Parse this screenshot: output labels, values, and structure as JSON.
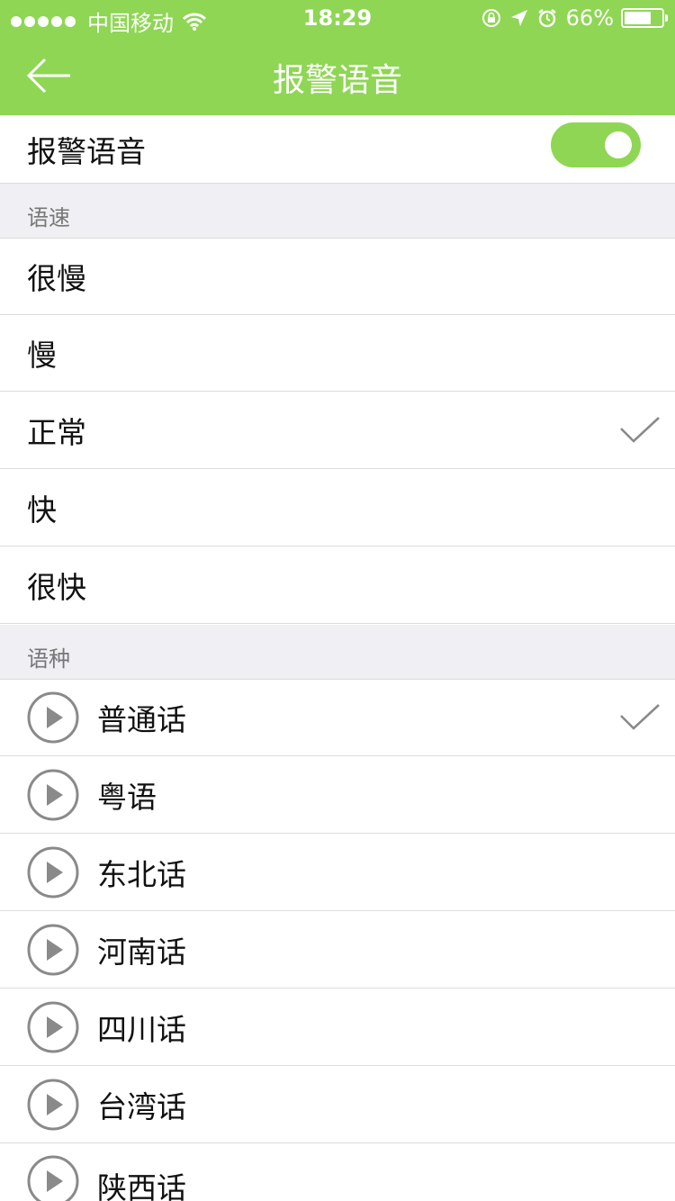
{
  "status_bar": {
    "carrier": "中国移动",
    "time": "18:29",
    "battery": "66%"
  },
  "nav": {
    "title": "报警语音"
  },
  "alarm_toggle": {
    "label": "报警语音",
    "enabled": true
  },
  "speed_section": {
    "header": "语速",
    "options": [
      "很慢",
      "慢",
      "正常",
      "快",
      "很快"
    ],
    "selected": "正常"
  },
  "language_section": {
    "header": "语种",
    "options": [
      "普通话",
      "粤语",
      "东北话",
      "河南话",
      "四川话",
      "台湾话",
      "陕西话"
    ],
    "selected": "普通话"
  },
  "colors": {
    "accent": "#8fd654",
    "section_bg": "#efeff4",
    "divider": "#dcdcdc"
  }
}
